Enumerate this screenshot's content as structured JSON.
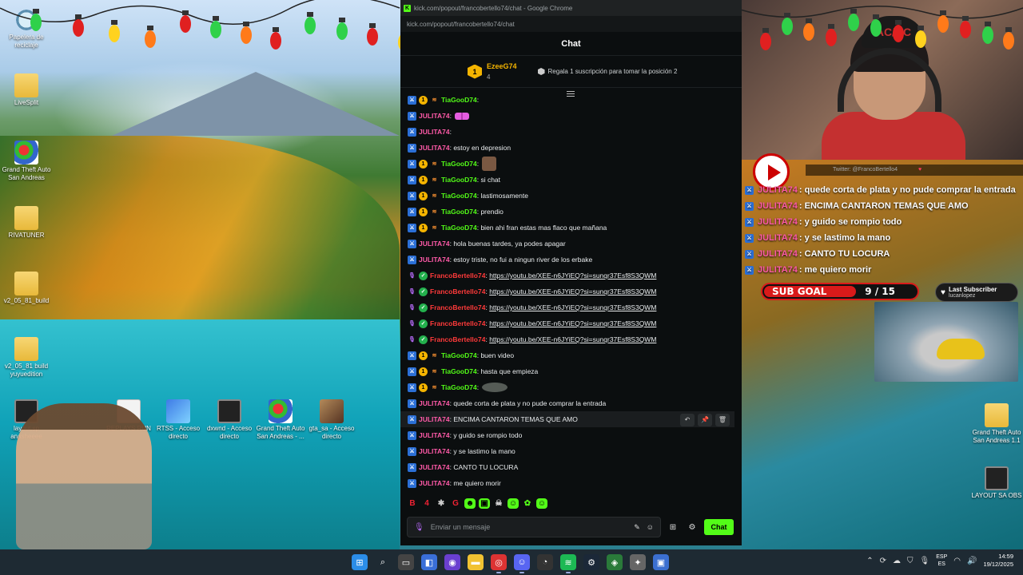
{
  "window": {
    "title": "kick.com/popout/francobertello74/chat - Google Chrome",
    "address": "kick.com/popout/francobertello74/chat"
  },
  "chat_header": {
    "title": "Chat"
  },
  "pinned_gifter": {
    "rank": "1",
    "username": "EzeeG74",
    "count": "4",
    "note": "Regala 1 suscripción para tomar la posición 2"
  },
  "messages": [
    {
      "user": "TiaGooD74",
      "color": "tiago",
      "badges": [
        "mod",
        "sub",
        "gift"
      ],
      "text": "",
      "emote": ""
    },
    {
      "user": "JULITA74",
      "color": "julita",
      "badges": [
        "mod"
      ],
      "text": "",
      "emote": "bow"
    },
    {
      "user": "JULITA74",
      "color": "julita",
      "badges": [
        "mod"
      ],
      "text": "",
      "emote": ""
    },
    {
      "user": "JULITA74",
      "color": "julita",
      "badges": [
        "mod"
      ],
      "text": "estoy en depresion",
      "emote": ""
    },
    {
      "user": "TiaGooD74",
      "color": "tiago",
      "badges": [
        "mod",
        "sub",
        "gift"
      ],
      "text": "",
      "emote": "face"
    },
    {
      "user": "TiaGooD74",
      "color": "tiago",
      "badges": [
        "mod",
        "sub",
        "gift"
      ],
      "text": "si chat",
      "emote": ""
    },
    {
      "user": "TiaGooD74",
      "color": "tiago",
      "badges": [
        "mod",
        "sub",
        "gift"
      ],
      "text": "lastimosamente",
      "emote": ""
    },
    {
      "user": "TiaGooD74",
      "color": "tiago",
      "badges": [
        "mod",
        "sub",
        "gift"
      ],
      "text": "prendio",
      "emote": ""
    },
    {
      "user": "TiaGooD74",
      "color": "tiago",
      "badges": [
        "mod",
        "sub",
        "gift"
      ],
      "text": "bien ahi fran estas mas flaco que mañana",
      "emote": ""
    },
    {
      "user": "JULITA74",
      "color": "julita",
      "badges": [
        "mod"
      ],
      "text": "hola buenas tardes, ya podes apagar",
      "emote": ""
    },
    {
      "user": "JULITA74",
      "color": "julita",
      "badges": [
        "mod"
      ],
      "text": "estoy triste, no fui a ningun river de los erbake",
      "emote": ""
    },
    {
      "user": "FrancoBertello74",
      "color": "franco",
      "badges": [
        "mic",
        "verified"
      ],
      "text": "https://youtu.be/XEE-n6JYiEQ?si=sunqr37Esf8S3QWM",
      "emote": "",
      "link": true
    },
    {
      "user": "FrancoBertello74",
      "color": "franco",
      "badges": [
        "mic",
        "verified"
      ],
      "text": "https://youtu.be/XEE-n6JYiEQ?si=sunqr37Esf8S3QWM",
      "emote": "",
      "link": true
    },
    {
      "user": "FrancoBertello74",
      "color": "franco",
      "badges": [
        "mic",
        "verified"
      ],
      "text": "https://youtu.be/XEE-n6JYiEQ?si=sunqr37Esf8S3QWM",
      "emote": "",
      "link": true
    },
    {
      "user": "FrancoBertello74",
      "color": "franco",
      "badges": [
        "mic",
        "verified"
      ],
      "text": "https://youtu.be/XEE-n6JYiEQ?si=sunqr37Esf8S3QWM",
      "emote": "",
      "link": true
    },
    {
      "user": "FrancoBertello74",
      "color": "franco",
      "badges": [
        "mic",
        "verified"
      ],
      "text": "https://youtu.be/XEE-n6JYiEQ?si=sunqr37Esf8S3QWM",
      "emote": "",
      "link": true
    },
    {
      "user": "TiaGooD74",
      "color": "tiago",
      "badges": [
        "mod",
        "sub",
        "gift"
      ],
      "text": "buen video",
      "emote": ""
    },
    {
      "user": "TiaGooD74",
      "color": "tiago",
      "badges": [
        "mod",
        "sub",
        "gift"
      ],
      "text": "hasta que empieza",
      "emote": ""
    },
    {
      "user": "TiaGooD74",
      "color": "tiago",
      "badges": [
        "mod",
        "sub",
        "gift"
      ],
      "text": "",
      "emote": "blob"
    },
    {
      "user": "JULITA74",
      "color": "julita",
      "badges": [
        "mod"
      ],
      "text": "quede corta de plata y no pude comprar la entrada",
      "emote": ""
    },
    {
      "user": "JULITA74",
      "color": "julita",
      "badges": [
        "mod"
      ],
      "text": "ENCIMA CANTARON TEMAS QUE AMO",
      "emote": "",
      "hover": true
    },
    {
      "user": "JULITA74",
      "color": "julita",
      "badges": [
        "mod"
      ],
      "text": "y guido se rompio todo",
      "emote": ""
    },
    {
      "user": "JULITA74",
      "color": "julita",
      "badges": [
        "mod"
      ],
      "text": "y se lastimo la mano",
      "emote": ""
    },
    {
      "user": "JULITA74",
      "color": "julita",
      "badges": [
        "mod"
      ],
      "text": "CANTO TU LOCURA",
      "emote": ""
    },
    {
      "user": "JULITA74",
      "color": "julita",
      "badges": [
        "mod"
      ],
      "text": "me quiero morir",
      "emote": ""
    }
  ],
  "message_actions": [
    "reply",
    "pin",
    "delete"
  ],
  "chat_input": {
    "placeholder": "Enviar un mensaje",
    "send_label": "Chat"
  },
  "overlay": {
    "twitter": "Twitter: @FrancoBertello4",
    "chat": [
      {
        "user": "JULITA74",
        "text": ": quede corta de plata y no pude comprar la entrada"
      },
      {
        "user": "JULITA74",
        "text": ": ENCIMA CANTARON TEMAS QUE AMO"
      },
      {
        "user": "JULITA74",
        "text": ": y guido se rompio todo"
      },
      {
        "user": "JULITA74",
        "text": ": y se lastimo la mano"
      },
      {
        "user": "JULITA74",
        "text": ": CANTO TU LOCURA"
      },
      {
        "user": "JULITA74",
        "text": ": me quiero morir"
      }
    ],
    "sub_goal": {
      "label": "SUB GOAL",
      "current": 9,
      "target": 15,
      "display": "9 / 15"
    },
    "last_subscriber": {
      "title": "Last Subscriber",
      "name": "lucanlopez"
    },
    "webcam_cap_text": "AC/DC"
  },
  "desktop_icons": [
    {
      "label": "Papelera de reciclaje",
      "kind": "bin"
    },
    {
      "label": "LiveSplit",
      "kind": "folder"
    },
    {
      "label": "Grand Theft Auto San Andreas",
      "kind": "gta"
    },
    {
      "label": "RIVATUNER",
      "kind": "folder"
    },
    {
      "label": "v2_05_81_build",
      "kind": "folder"
    },
    {
      "label": "v2_05_81 build yuyuedition",
      "kind": "folder"
    },
    {
      "label": "layout.sp anasheeee",
      "kind": "dark"
    },
    {
      "label": "REPLAYS RUN",
      "kind": "doc"
    },
    {
      "label": "RTSS - Acceso directo",
      "kind": "win"
    },
    {
      "label": "dxwnd - Acceso directo",
      "kind": "dark"
    },
    {
      "label": "Grand Theft Auto San Andreas - ...",
      "kind": "gta"
    },
    {
      "label": "gta_sa - Acceso directo",
      "kind": "photo"
    },
    {
      "label": "Grand Theft Auto San Andreas 1.1",
      "kind": "folder"
    },
    {
      "label": "LAYOUT SA OBS",
      "kind": "dark"
    }
  ],
  "taskbar": {
    "apps": [
      "start",
      "search",
      "taskview",
      "store",
      "obs",
      "explorer",
      "chrome",
      "discord",
      "speedrun",
      "spotify",
      "steam",
      "gta",
      "misc",
      "monitor"
    ],
    "language": "ESP",
    "region": "ES",
    "time": "14:59",
    "date": "19/12/2025"
  },
  "colors": {
    "kick_green": "#53fc18",
    "julita": "#ff5aa8",
    "tiago": "#53fc18",
    "franco": "#ff3a3a",
    "goal_red": "#d91a1a"
  }
}
